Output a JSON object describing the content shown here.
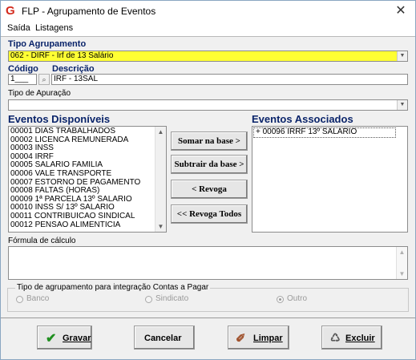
{
  "window": {
    "title": "FLP - Agrupamento de Eventos",
    "close_glyph": "✕",
    "app_icon_glyph": "G"
  },
  "menu": [
    "Saída",
    "Listagens"
  ],
  "tipo_agrupamento": {
    "label": "Tipo Agrupamento",
    "value": "062 - DIRF - Irf de 13 Salário",
    "highlight_color": "#ffff33"
  },
  "codigo": {
    "label": "Código",
    "value": "1___"
  },
  "descricao": {
    "label": "Descrição",
    "value": "IRF - 13SAL"
  },
  "tipo_apuracao": {
    "label": "Tipo de Apuração",
    "value": ""
  },
  "eventos_disponiveis": {
    "label": "Eventos Disponíveis",
    "items": [
      "00001 DIAS TRABALHADOS",
      "00002 LICENCA REMUNERADA",
      "00003 INSS",
      "00004 IRRF",
      "00005 SALARIO FAMILIA",
      "00006 VALE TRANSPORTE",
      "00007 ESTORNO DE PAGAMENTO",
      "00008 FALTAS (HORAS)",
      "00009 1ª PARCELA 13º SALARIO",
      "00010 INSS S/ 13º SALARIO",
      "00011 CONTRIBUICAO SINDICAL",
      "00012 PENSAO ALIMENTICIA"
    ]
  },
  "eventos_associados": {
    "label": "Eventos Associados",
    "items": [
      "+ 00096 IRRF 13º SALARIO"
    ]
  },
  "middle_buttons": {
    "somar": "Somar  na base >",
    "subtrair": "Subtrair da base >",
    "revoga": "< Revoga",
    "revoga_todos": "<< Revoga Todos"
  },
  "formula": {
    "label": "Fórmula de cálculo",
    "value": ""
  },
  "integracao": {
    "label": "Tipo de agrupamento para integração Contas a Pagar",
    "options": [
      "Banco",
      "Sindicato",
      "Outro"
    ],
    "selected": "Outro"
  },
  "bottom_buttons": {
    "gravar": "Gravar",
    "cancelar": "Cancelar",
    "limpar": "Limpar",
    "excluir": "Excluir"
  },
  "colors": {
    "label_blue": "#0a246a",
    "title_red": "#d42b1e",
    "gravar_check": "#1f8f1f"
  }
}
